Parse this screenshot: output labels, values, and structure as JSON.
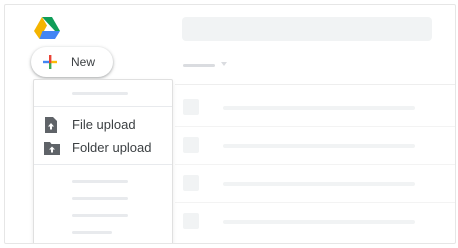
{
  "app": {
    "logo_icon": "google-drive-logo-icon"
  },
  "new_button": {
    "label": "New",
    "icon": "plus-icon"
  },
  "new_menu": {
    "items": [
      {
        "label": "File upload",
        "icon": "file-upload-icon"
      },
      {
        "label": "Folder upload",
        "icon": "folder-upload-icon"
      }
    ]
  },
  "colors": {
    "drive_green": "#0F9D58",
    "drive_yellow": "#F4B400",
    "drive_blue": "#4285F4",
    "plus_red": "#EA4335",
    "icon_gray": "#5f6368",
    "placeholder_gray": "#f1f3f4"
  }
}
